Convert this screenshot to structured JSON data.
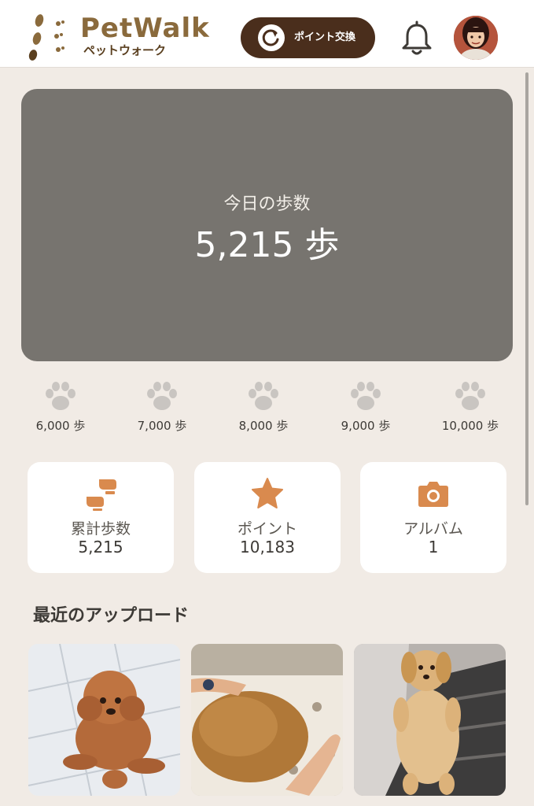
{
  "header": {
    "logo_title": "PetWalk",
    "logo_subtitle": "ペットウォーク",
    "exchange_button_label": "ポイント交換",
    "icons": [
      "footprints-logo-icon",
      "refresh-icon",
      "bell-icon",
      "avatar"
    ]
  },
  "today": {
    "label": "今日の歩数",
    "value": "5,215 歩"
  },
  "milestones": [
    {
      "label": "6,000 歩"
    },
    {
      "label": "7,000 歩"
    },
    {
      "label": "8,000 歩"
    },
    {
      "label": "9,000 歩"
    },
    {
      "label": "10,000 歩"
    }
  ],
  "stats": [
    {
      "icon": "footprints-icon",
      "label": "累計歩数",
      "value": "5,215"
    },
    {
      "icon": "star-icon",
      "label": "ポイント",
      "value": "10,183"
    },
    {
      "icon": "camera-icon",
      "label": "アルバム",
      "value": "1"
    }
  ],
  "recent": {
    "title": "最近のアップロード",
    "photos": [
      {
        "subject": "toy-poodle-photo"
      },
      {
        "subject": "dachshund-held-photo"
      },
      {
        "subject": "dachshund-lying-photo"
      }
    ]
  },
  "colors": {
    "background": "#f1ebe5",
    "card_gray": "#77746f",
    "brand_brown": "#4a2e1c",
    "accent_orange": "#d98a4e",
    "paw_gray": "#c9c5c1"
  }
}
